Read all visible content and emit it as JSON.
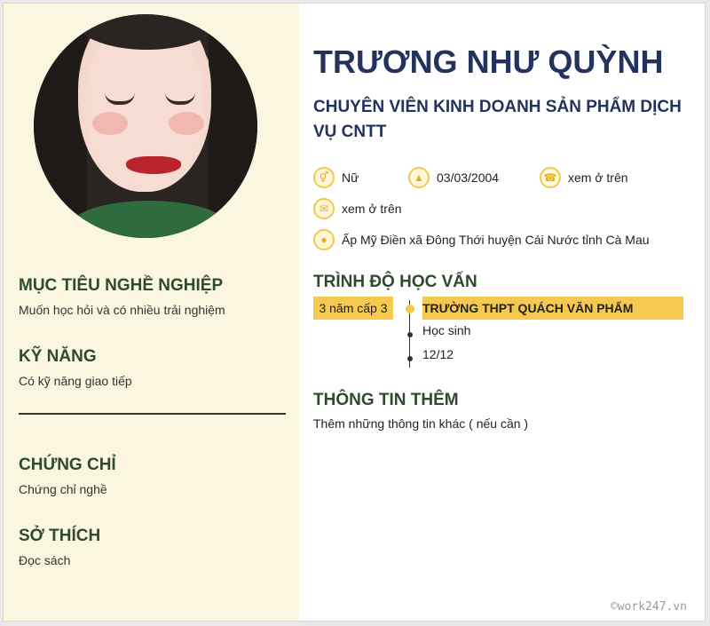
{
  "profile": {
    "name": "TRƯƠNG NHƯ QUỲNH",
    "job_title": "CHUYÊN VIÊN KINH DOANH SẢN PHẨM DỊCH VỤ CNTT",
    "gender": "Nữ",
    "birthday": "03/03/2004",
    "phone": "xem ở trên",
    "email": "xem ở trên",
    "address": "Ấp Mỹ Điền xã Đông Thới huyện Cái Nước tỉnh Cà Mau"
  },
  "left": {
    "objective": {
      "heading": "MỤC TIÊU NGHỀ NGHIỆP",
      "text": "Muốn học hỏi và có nhiều trải nghiệm"
    },
    "skills": {
      "heading": "KỸ NĂNG",
      "text": "Có kỹ năng giao tiếp"
    },
    "certificates": {
      "heading": "CHỨNG CHỈ",
      "text": "Chứng chỉ nghề"
    },
    "hobbies": {
      "heading": "SỞ THÍCH",
      "text": "Đọc sách"
    }
  },
  "education": {
    "heading": "TRÌNH ĐỘ HỌC VẤN",
    "period": "3 năm cấp 3",
    "school": "TRƯỜNG THPT QUÁCH VĂN PHẨM",
    "major": "Học sinh",
    "grade": "12/12"
  },
  "extra": {
    "heading": "THÔNG TIN THÊM",
    "text": "Thêm những thông tin khác ( nếu cần )"
  },
  "icons": [
    "gender-icon",
    "birthday-cake-icon",
    "phone-icon",
    "email-icon",
    "location-icon"
  ],
  "colors": {
    "accent": "#f5c84f",
    "name": "#24335e",
    "heading": "#2f4a2c",
    "sidebar": "#fbf6df"
  },
  "watermark": "©work247.vn"
}
